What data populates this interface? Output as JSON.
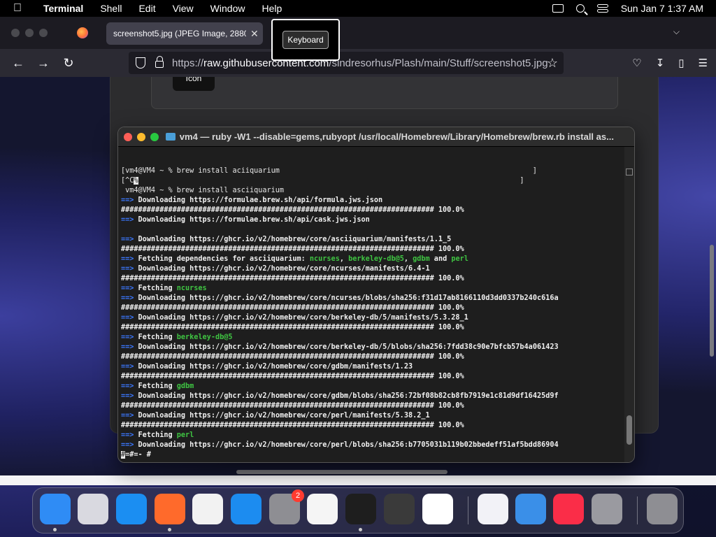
{
  "menubar": {
    "app_name": "Terminal",
    "items": [
      "Shell",
      "Edit",
      "View",
      "Window",
      "Help"
    ],
    "clock": "Sun Jan 7  1:37 AM"
  },
  "browser": {
    "tab_title": "screenshot5.jpg (JPEG Image, 2880",
    "url_prefix": "https://",
    "url_host": "raw.githubusercontent.com",
    "url_path": "/sindresorhus/Plash/main/Stuff/screenshot5.jpg"
  },
  "overlay": {
    "keyboard_label": "Keyboard"
  },
  "screenshot": {
    "plash_button_label": "Icon"
  },
  "terminal": {
    "title": "vm4 — ruby -W1 --disable=gems,rubyopt /usr/local/Homebrew/Library/Homebrew/brew.rb install as...",
    "lines": [
      {
        "parts": [
          {
            "t": "[vm4@VM4 ~ % brew install aciiquarium                                                           ]",
            "c": ""
          }
        ]
      },
      {
        "parts": [
          {
            "t": "[^C",
            "c": ""
          },
          {
            "t": "%",
            "c": "cursor"
          },
          {
            "t": "                                                                                         ]",
            "c": ""
          }
        ]
      },
      {
        "parts": [
          {
            "t": " vm4@VM4 ~ % brew install asciiquarium",
            "c": ""
          }
        ]
      },
      {
        "parts": [
          {
            "t": "==> ",
            "c": "c-arrow"
          },
          {
            "t": "Downloading https://formulae.brew.sh/api/formula.jws.json",
            "c": "c-bold"
          }
        ]
      },
      {
        "parts": [
          {
            "t": "######################################################################### 100.0%",
            "c": "c-hash"
          }
        ]
      },
      {
        "parts": [
          {
            "t": "==> ",
            "c": "c-arrow"
          },
          {
            "t": "Downloading https://formulae.brew.sh/api/cask.jws.json",
            "c": "c-bold"
          }
        ]
      },
      {
        "parts": [
          {
            "t": "",
            "c": ""
          }
        ]
      },
      {
        "parts": [
          {
            "t": "==> ",
            "c": "c-arrow"
          },
          {
            "t": "Downloading https://ghcr.io/v2/homebrew/core/asciiquarium/manifests/1.1_5",
            "c": "c-bold"
          }
        ]
      },
      {
        "parts": [
          {
            "t": "######################################################################### 100.0%",
            "c": "c-hash"
          }
        ]
      },
      {
        "parts": [
          {
            "t": "==> ",
            "c": "c-arrow"
          },
          {
            "t": "Fetching dependencies for asciiquarium: ",
            "c": "c-bold"
          },
          {
            "t": "ncurses",
            "c": "c-green"
          },
          {
            "t": ", ",
            "c": "c-bold"
          },
          {
            "t": "berkeley-db@5",
            "c": "c-green"
          },
          {
            "t": ", ",
            "c": "c-bold"
          },
          {
            "t": "gdbm",
            "c": "c-green"
          },
          {
            "t": " and ",
            "c": "c-bold"
          },
          {
            "t": "perl",
            "c": "c-green"
          }
        ]
      },
      {
        "parts": [
          {
            "t": "==> ",
            "c": "c-arrow"
          },
          {
            "t": "Downloading https://ghcr.io/v2/homebrew/core/ncurses/manifests/6.4-1",
            "c": "c-bold"
          }
        ]
      },
      {
        "parts": [
          {
            "t": "######################################################################### 100.0%",
            "c": "c-hash"
          }
        ]
      },
      {
        "parts": [
          {
            "t": "==> ",
            "c": "c-arrow"
          },
          {
            "t": "Fetching ",
            "c": "c-bold"
          },
          {
            "t": "ncurses",
            "c": "c-green"
          }
        ]
      },
      {
        "parts": [
          {
            "t": "==> ",
            "c": "c-arrow"
          },
          {
            "t": "Downloading https://ghcr.io/v2/homebrew/core/ncurses/blobs/sha256:f31d17ab8166110d3dd0337b240c616a",
            "c": "c-bold"
          }
        ]
      },
      {
        "parts": [
          {
            "t": "######################################################################### 100.0%",
            "c": "c-hash"
          }
        ]
      },
      {
        "parts": [
          {
            "t": "==> ",
            "c": "c-arrow"
          },
          {
            "t": "Downloading https://ghcr.io/v2/homebrew/core/berkeley-db/5/manifests/5.3.28_1",
            "c": "c-bold"
          }
        ]
      },
      {
        "parts": [
          {
            "t": "######################################################################### 100.0%",
            "c": "c-hash"
          }
        ]
      },
      {
        "parts": [
          {
            "t": "==> ",
            "c": "c-arrow"
          },
          {
            "t": "Fetching ",
            "c": "c-bold"
          },
          {
            "t": "berkeley-db@5",
            "c": "c-green"
          }
        ]
      },
      {
        "parts": [
          {
            "t": "==> ",
            "c": "c-arrow"
          },
          {
            "t": "Downloading https://ghcr.io/v2/homebrew/core/berkeley-db/5/blobs/sha256:7fdd38c90e7bfcb57b4a061423",
            "c": "c-bold"
          }
        ]
      },
      {
        "parts": [
          {
            "t": "######################################################################### 100.0%",
            "c": "c-hash"
          }
        ]
      },
      {
        "parts": [
          {
            "t": "==> ",
            "c": "c-arrow"
          },
          {
            "t": "Downloading https://ghcr.io/v2/homebrew/core/gdbm/manifests/1.23",
            "c": "c-bold"
          }
        ]
      },
      {
        "parts": [
          {
            "t": "######################################################################### 100.0%",
            "c": "c-hash"
          }
        ]
      },
      {
        "parts": [
          {
            "t": "==> ",
            "c": "c-arrow"
          },
          {
            "t": "Fetching ",
            "c": "c-bold"
          },
          {
            "t": "gdbm",
            "c": "c-green"
          }
        ]
      },
      {
        "parts": [
          {
            "t": "==> ",
            "c": "c-arrow"
          },
          {
            "t": "Downloading https://ghcr.io/v2/homebrew/core/gdbm/blobs/sha256:72bf08b82cb8fb7919e1c81d9df16425d9f",
            "c": "c-bold"
          }
        ]
      },
      {
        "parts": [
          {
            "t": "######################################################################### 100.0%",
            "c": "c-hash"
          }
        ]
      },
      {
        "parts": [
          {
            "t": "==> ",
            "c": "c-arrow"
          },
          {
            "t": "Downloading https://ghcr.io/v2/homebrew/core/perl/manifests/5.38.2_1",
            "c": "c-bold"
          }
        ]
      },
      {
        "parts": [
          {
            "t": "######################################################################### 100.0%",
            "c": "c-hash"
          }
        ]
      },
      {
        "parts": [
          {
            "t": "==> ",
            "c": "c-arrow"
          },
          {
            "t": "Fetching ",
            "c": "c-bold"
          },
          {
            "t": "perl",
            "c": "c-green"
          }
        ]
      },
      {
        "parts": [
          {
            "t": "==> ",
            "c": "c-arrow"
          },
          {
            "t": "Downloading https://ghcr.io/v2/homebrew/core/perl/blobs/sha256:b7705031b119b02bbedeff51af5bdd86904",
            "c": "c-bold"
          }
        ]
      },
      {
        "parts": [
          {
            "t": "#",
            "c": "cursor"
          },
          {
            "t": "=#=- #",
            "c": "c-hash"
          }
        ]
      }
    ]
  },
  "dock": {
    "items": [
      {
        "name": "finder-icon",
        "color": "#2f8cf5",
        "running": true
      },
      {
        "name": "launchpad-icon",
        "color": "#d9d9e0",
        "running": false
      },
      {
        "name": "safari-icon",
        "color": "#1b8ef2",
        "running": false
      },
      {
        "name": "firefox-icon",
        "color": "#ff6a2b",
        "running": true
      },
      {
        "name": "chrome-icon",
        "color": "#f2f2f2",
        "running": false
      },
      {
        "name": "app-store-icon",
        "color": "#1c8cf0",
        "running": false
      },
      {
        "name": "system-settings-icon",
        "color": "#8e8e93",
        "running": false,
        "badge": "2"
      },
      {
        "name": "textedit-icon",
        "color": "#f5f5f5",
        "running": false
      },
      {
        "name": "terminal-icon",
        "color": "#1e1e1e",
        "running": true
      },
      {
        "name": "garageband-icon",
        "color": "#3a3a3a",
        "running": false
      },
      {
        "name": "vscode-icon",
        "color": "#ffffff",
        "running": false
      },
      {
        "name": "visual-studio-icon",
        "color": "#f2f2f7",
        "running": false
      },
      {
        "name": "weather-icon",
        "color": "#3a8fe8",
        "running": false
      },
      {
        "name": "music-icon",
        "color": "#fa2d48",
        "running": false
      },
      {
        "name": "script-editor-icon",
        "color": "#9a9aa0",
        "running": false
      },
      {
        "name": "trash-icon",
        "color": "#8e8e93",
        "running": false
      }
    ]
  }
}
